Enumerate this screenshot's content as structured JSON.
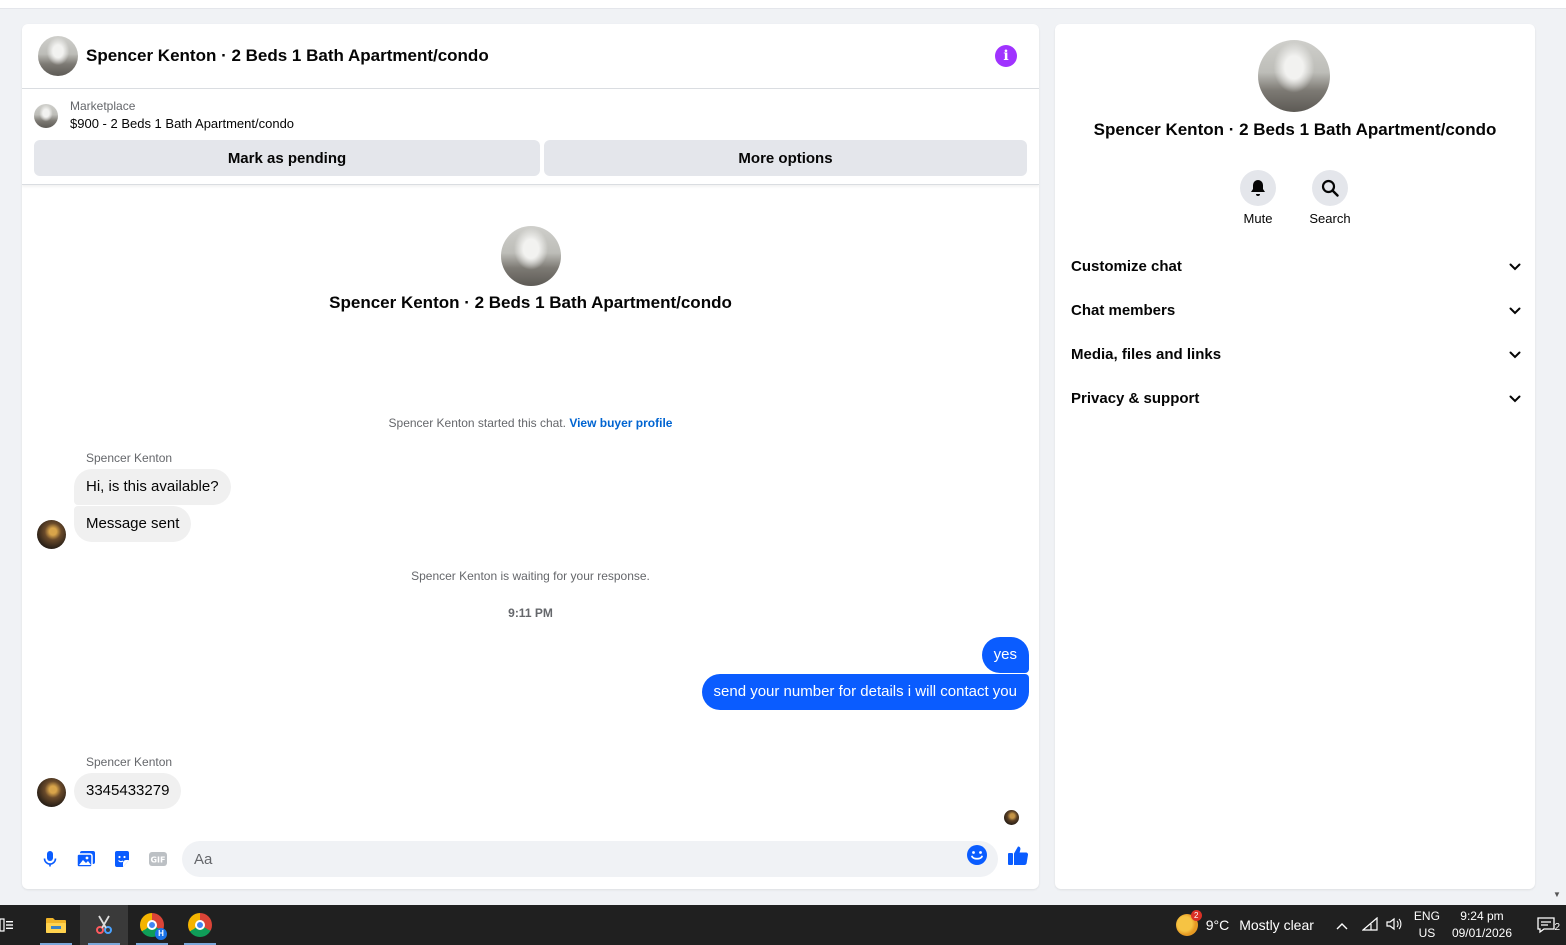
{
  "chat": {
    "header_title": "Spencer Kenton · 2 Beds 1 Bath Apartment/condo",
    "listing": {
      "label": "Marketplace",
      "price_title": "$900 - 2 Beds 1 Bath Apartment/condo",
      "mark_pending": "Mark as pending",
      "more_options": "More options"
    },
    "intro_title": "Spencer Kenton · 2 Beds 1 Bath Apartment/condo",
    "started_text": "Spencer Kenton started this chat.",
    "view_buyer_profile": "View buyer profile",
    "sender_name": "Spencer Kenton",
    "messages_in_1": [
      "Hi, is this available?",
      "Message sent"
    ],
    "waiting_text": "Spencer Kenton is waiting for your response.",
    "timestamp": "9:11 PM",
    "messages_out": [
      "yes",
      "send your number for details i will contact you"
    ],
    "sender_name_2": "Spencer Kenton",
    "messages_in_2": [
      "3345433279"
    ],
    "composer_placeholder": "Aa"
  },
  "side": {
    "title": "Spencer Kenton · 2 Beds 1 Bath Apartment/condo",
    "actions": [
      {
        "label": "Mute",
        "icon": "bell-icon"
      },
      {
        "label": "Search",
        "icon": "search-icon"
      }
    ],
    "sections": [
      "Customize chat",
      "Chat members",
      "Media, files and links",
      "Privacy & support"
    ]
  },
  "taskbar": {
    "weather_temp": "9°C",
    "weather_desc": "Mostly clear",
    "weather_badge": "2",
    "lang_1": "ENG",
    "lang_2": "US",
    "time": "9:24 pm",
    "date": "09/01/2026",
    "notif_count": "2",
    "chrome_badge": "H"
  },
  "colors": {
    "accent_blue": "#0a5cff",
    "info_purple": "#a033ff",
    "link_blue": "#0064d1"
  }
}
